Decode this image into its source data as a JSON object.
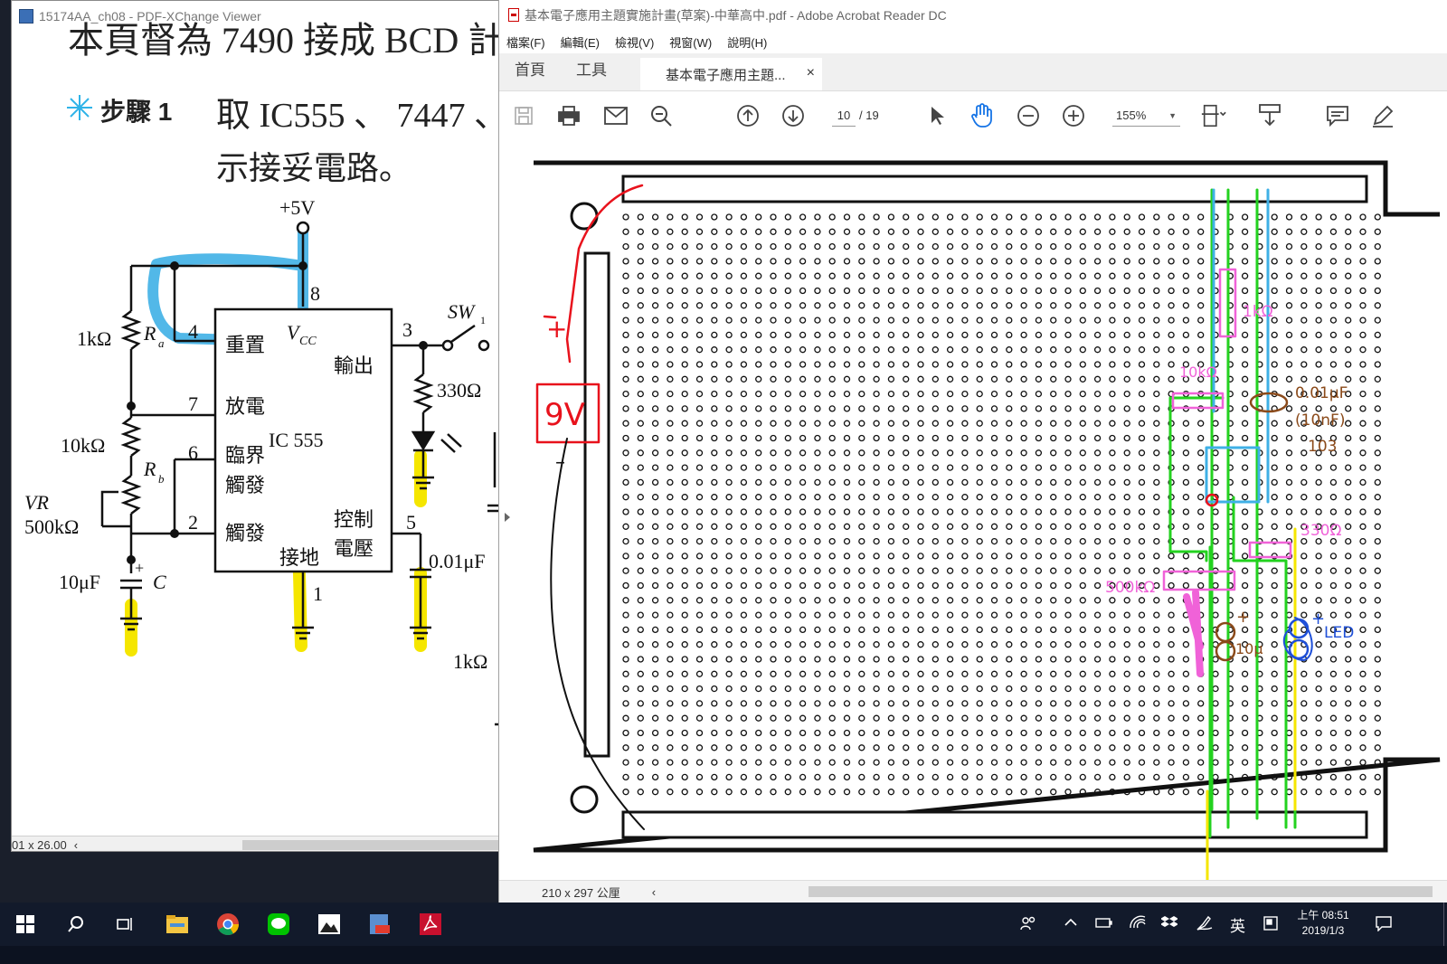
{
  "left_window": {
    "title": "15174AA_ch08 - PDF-XChange Viewer",
    "heading_fragment": "本頁督為 7490 接成 BCD 計",
    "step_label": "步驟 1",
    "step_text_line1": "取 IC555 、 7447 、",
    "step_text_line2": "示接妥電路。",
    "status_size": "01 x 26.00",
    "status_arrow": "‹",
    "circuit": {
      "vcc": "+5V",
      "r1": "1kΩ",
      "ra": "R",
      "ra_sub": "a",
      "r2": "10kΩ",
      "rb": "R",
      "rb_sub": "b",
      "vr": "VR",
      "vr_val": "500kΩ",
      "cap": "10μF",
      "cap_plus": "+",
      "cap_name": "C",
      "pin4": "4",
      "pin7": "7",
      "pin6": "6",
      "pin2": "2",
      "pin8": "8",
      "pin3": "3",
      "pin5": "5",
      "pin1": "1",
      "reset": "重置",
      "vcc_label": "V",
      "vcc_sub": "CC",
      "output": "輸出",
      "discharge": "放電",
      "ic": "IC 555",
      "threshold1": "臨界",
      "threshold2": "觸發",
      "trigger": "觸發",
      "control1": "控制",
      "control2": "電壓",
      "ground": "接地",
      "sw": "SW",
      "sw_sub": "1",
      "r330": "330Ω",
      "c001": "0.01μF",
      "r1k_bottom": "1kΩ"
    }
  },
  "right_window": {
    "title": "基本電子應用主題實施計畫(草案)-中華高中.pdf - Adobe Acrobat Reader DC",
    "menu": [
      "檔案(F)",
      "編輯(E)",
      "檢視(V)",
      "視窗(W)",
      "說明(H)"
    ],
    "tabs": {
      "home": "首頁",
      "tools": "工具",
      "document": "基本電子應用主題...",
      "close": "×"
    },
    "toolbar": {
      "page_current": "10",
      "page_total": "/ 19",
      "zoom": "155%",
      "zoom_dropdown": "▼"
    },
    "status": {
      "page_size": "210 x 297 公厘",
      "scroll_arrow": "‹"
    },
    "sheet_annotations": {
      "plus": "+",
      "battery": "9V",
      "minus": "–",
      "r_1k": "1kΩ",
      "r_10k": "10kΩ",
      "cap_001": "0.01μF",
      "cap_10nf": "(10nF)",
      "cap_code": "103",
      "r_330": "330Ω",
      "r_500k": "500kΩ",
      "cap_plus": "+",
      "cap_10u": "10μ",
      "led_plus": "+",
      "led": "LED"
    }
  },
  "taskbar": {
    "ime": "英",
    "time": "上午 08:51",
    "date": "2019/1/3"
  },
  "colors": {
    "highlight_blue": "#3fb0e6",
    "highlight_yellow": "#f5e600",
    "ink_red": "#e8121c",
    "ink_green": "#23d21f",
    "ink_pink": "#f062d8",
    "ink_brown": "#8b4a1a",
    "ink_blue": "#1e4fd8",
    "taskbar": "#121a2b"
  }
}
